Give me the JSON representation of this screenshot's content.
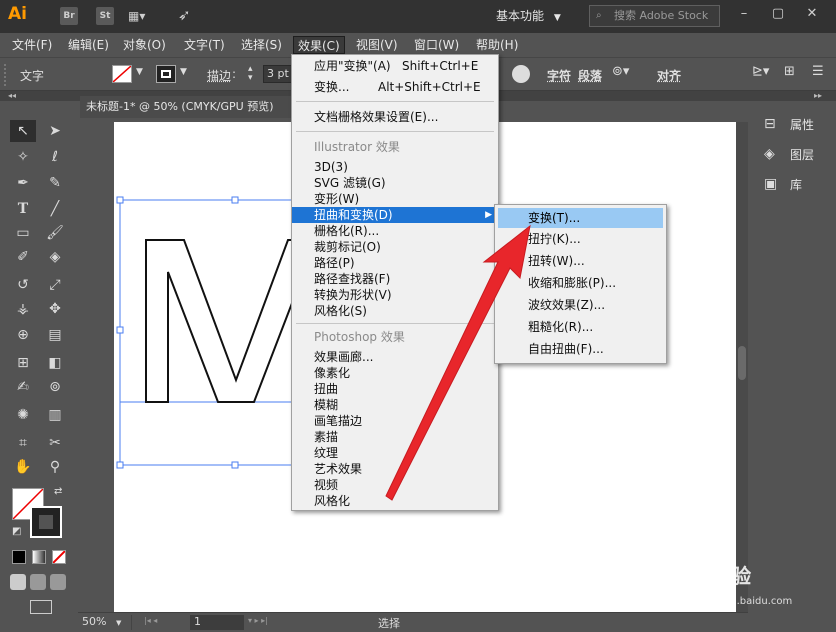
{
  "titlebar": {
    "logo": "Ai",
    "badges": [
      "Br",
      "St"
    ],
    "workspace": "基本功能",
    "search_placeholder": "搜索 Adobe Stock"
  },
  "menubar": {
    "items": [
      "文件(F)",
      "编辑(E)",
      "对象(O)",
      "文字(T)",
      "选择(S)",
      "效果(C)",
      "视图(V)",
      "窗口(W)",
      "帮助(H)"
    ],
    "active": "效果(C)"
  },
  "controlbar": {
    "mode_label": "文字",
    "stroke_label": "描边",
    "stroke_value": "3 pt",
    "char_label": "字符",
    "para_label": "段落",
    "align_label": "对齐"
  },
  "document": {
    "tab_title": "未标题-1* @ 50% (CMYK/GPU 预览)"
  },
  "right_panel": {
    "items": [
      "属性",
      "图层",
      "库"
    ]
  },
  "statusbar": {
    "zoom": "50%",
    "page": "1",
    "tool": "选择"
  },
  "effect_menu": {
    "items": [
      {
        "label": "应用\"变换\"(A)",
        "shortcut": "Shift+Ctrl+E"
      },
      {
        "label": "变换...",
        "shortcut": "Alt+Shift+Ctrl+E"
      }
    ],
    "doc_raster": "文档栅格效果设置(E)...",
    "illustrator_header": "Illustrator 效果",
    "illustrator_items": [
      "3D(3)",
      "SVG 滤镜(G)",
      "变形(W)",
      "扭曲和变换(D)",
      "栅格化(R)...",
      "裁剪标记(O)",
      "路径(P)",
      "路径查找器(F)",
      "转换为形状(V)",
      "风格化(S)"
    ],
    "photoshop_header": "Photoshop 效果",
    "photoshop_items": [
      "效果画廊...",
      "像素化",
      "扭曲",
      "模糊",
      "画笔描边",
      "素描",
      "纹理",
      "艺术效果",
      "视频",
      "风格化"
    ]
  },
  "submenu": {
    "items": [
      "变换(T)...",
      "扭拧(K)...",
      "扭转(W)...",
      "收缩和膨胀(P)...",
      "波纹效果(Z)...",
      "粗糙化(R)...",
      "自由扭曲(F)..."
    ]
  },
  "artwork": {
    "letter": "M"
  },
  "watermark": {
    "text": "Baidu 经验",
    "url": "jingyan.baidu.com"
  },
  "colors": {
    "menu_highlight": "#1e74d4",
    "submenu_highlight": "#99c9f3",
    "arrow": "#e8262b",
    "logo": "#ff9a00"
  }
}
